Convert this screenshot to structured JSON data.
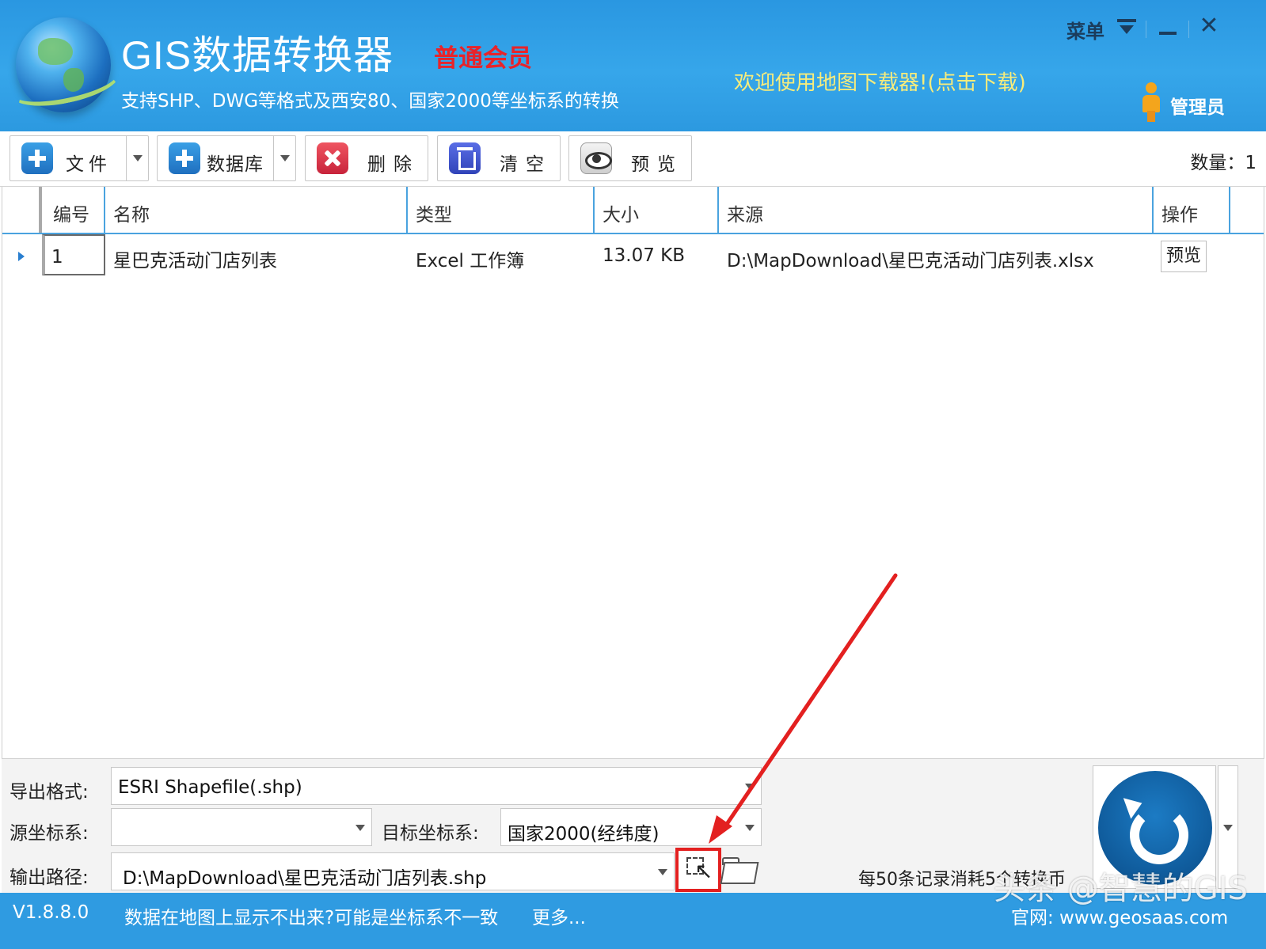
{
  "header": {
    "app_title": "GIS数据转换器",
    "member_level": "普通会员",
    "subtitle": "支持SHP、DWG等格式及西安80、国家2000等坐标系的转换",
    "welcome_link": "欢迎使用地图下载器!(点击下载)",
    "menu_label": "菜单",
    "close_glyph": "✕",
    "user_label": "管理员"
  },
  "toolbar": {
    "file_label": "文件",
    "database_label": "数据库",
    "delete_label": "删除",
    "clear_label": "清空",
    "preview_label": "预览",
    "count_text": "数量：1"
  },
  "grid": {
    "columns": [
      "编号",
      "名称",
      "类型",
      "大小",
      "来源",
      "操作"
    ],
    "rows": [
      {
        "id": "1",
        "name": "星巴克活动门店列表",
        "type": "Excel 工作簿",
        "size": "13.07 KB",
        "source": "D:\\MapDownload\\星巴克活动门店列表.xlsx",
        "action": "预览"
      }
    ]
  },
  "bottom": {
    "export_format_label": "导出格式:",
    "export_format_value": "ESRI Shapefile(.shp)",
    "source_crs_label": "源坐标系:",
    "source_crs_value": "",
    "target_crs_label": "目标坐标系:",
    "target_crs_value": "国家2000(经纬度)",
    "output_path_label": "输出路径:",
    "output_path_value": "D:\\MapDownload\\星巴克活动门店列表.shp",
    "cost_note": "每50条记录消耗5个转换币"
  },
  "status": {
    "version": "V1.8.8.0",
    "tip": "数据在地图上显示不出来?可能是坐标系不一致",
    "more": "更多...",
    "site": "官网:  www.geosaas.com"
  },
  "watermark": "头条 @智慧的GIS",
  "colors": {
    "header_blue": "#2a97e1",
    "member_red": "#e8232a",
    "welcome_yellow": "#f7ec7c",
    "annotation_red": "#e32020"
  },
  "icons": [
    "globe-logo-icon",
    "menu-caret-icon",
    "minimize-icon",
    "close-icon",
    "admin-user-icon",
    "add-file-icon",
    "add-database-icon",
    "delete-icon",
    "clear-icon",
    "preview-eye-icon",
    "row-pointer-icon",
    "select-area-icon",
    "folder-icon",
    "convert-icon"
  ]
}
